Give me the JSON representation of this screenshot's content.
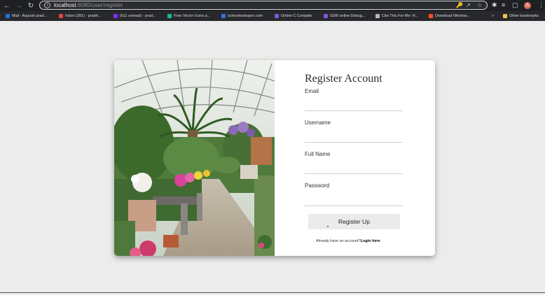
{
  "browser": {
    "url_host": "localhost",
    "url_path": ":8080/user/register",
    "profile_initial": "A"
  },
  "bookmarks": [
    {
      "label": "Mail - Aayush prad...",
      "color": "#1a73e8"
    },
    {
      "label": "Inbox (391) - pradh...",
      "color": "#ea4335"
    },
    {
      "label": "(611 unread) - prad...",
      "color": "#7b2ff7"
    },
    {
      "label": "Free Vector Icons a...",
      "color": "#1fb89a"
    },
    {
      "label": "schoolworkspro.com",
      "color": "#3b6fd8"
    },
    {
      "label": "Online C Compiler",
      "color": "#7b5bd6"
    },
    {
      "label": "GDB online Debug...",
      "color": "#8a4fd9"
    },
    {
      "label": "Cite This For Me: H...",
      "color": "#bbbbbb"
    },
    {
      "label": "Download Window...",
      "color": "#f25022"
    }
  ],
  "other_bookmarks": "Other bookmarks",
  "form": {
    "title": "Register Account",
    "email_label": "Email",
    "username_label": "Username",
    "fullname_label": "Full Name",
    "password_label": "Password",
    "submit_label": "Register Up",
    "login_prompt": "Already have an account?",
    "login_link": "Login here"
  }
}
